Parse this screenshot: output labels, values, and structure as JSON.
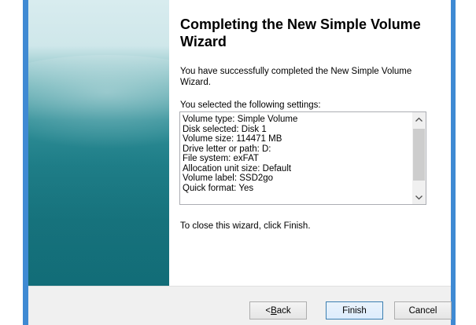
{
  "wizard": {
    "title": "Completing the New Simple Volume Wizard",
    "intro": "You have successfully completed the New Simple Volume Wizard.",
    "settings_label": "You selected the following settings:",
    "settings": [
      "Volume type: Simple Volume",
      "Disk selected: Disk 1",
      "Volume size: 114471 MB",
      "Drive letter or path: D:",
      "File system: exFAT",
      "Allocation unit size: Default",
      "Volume label: SSD2go",
      "Quick format: Yes"
    ],
    "closing": "To close this wizard, click Finish."
  },
  "buttons": {
    "back_accesskey": "B",
    "back_rest": "ack",
    "back_prefix": "< ",
    "finish": "Finish",
    "cancel": "Cancel"
  },
  "icons": {
    "scroll_up": "chevron-up-icon",
    "scroll_down": "chevron-down-icon"
  },
  "colors": {
    "frame": "#3f8ad3",
    "banner": "#1f7f89",
    "footer": "#f0f0f0"
  }
}
